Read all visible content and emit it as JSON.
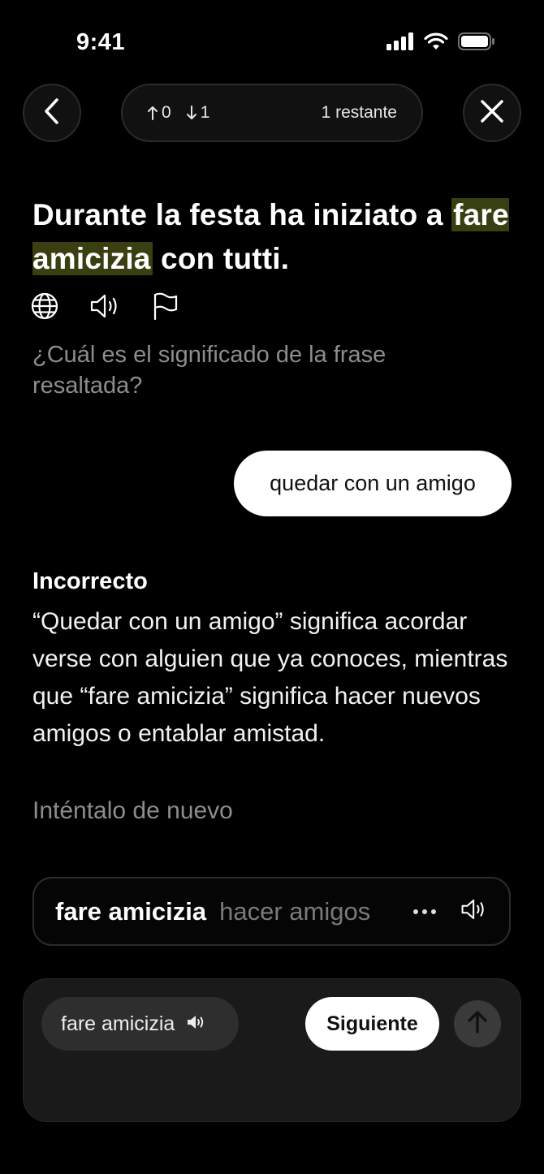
{
  "status_bar": {
    "time": "9:41"
  },
  "progress": {
    "correct_count": "0",
    "wrong_count": "1",
    "remaining_text": "1 restante"
  },
  "question": {
    "sentence_before": "Durante la festa ha iniziato a ",
    "highlight": "fare amicizia",
    "sentence_after": " con tutti.",
    "prompt": "¿Cuál es el significado de la frase resaltada?"
  },
  "answer": {
    "text": "quedar con un amigo"
  },
  "feedback": {
    "title": "Incorrecto",
    "body": "“Quedar con un amigo” significa acordar verse con alguien que ya conoces, mientras que “fare amicizia” significa hacer nuevos amigos o entablar amistad.",
    "retry": "Inténtalo de nuevo"
  },
  "phrase_card": {
    "phrase": "fare amicizia",
    "translation": "hacer amigos"
  },
  "bottom": {
    "chip_label": "fare amicizia",
    "next_label": "Siguiente"
  },
  "icons": {
    "back": "chevron-left-icon",
    "close": "close-icon",
    "up": "arrow-up-icon",
    "down": "arrow-down-icon",
    "translate": "globe-icon",
    "audio": "speaker-icon",
    "report": "flag-icon",
    "more": "ellipsis-icon",
    "send": "arrow-up-icon"
  },
  "colors": {
    "background": "#000000",
    "highlight": "#3a3f12",
    "muted_text": "#8d8d8d",
    "panel": "#1a1a1a"
  }
}
